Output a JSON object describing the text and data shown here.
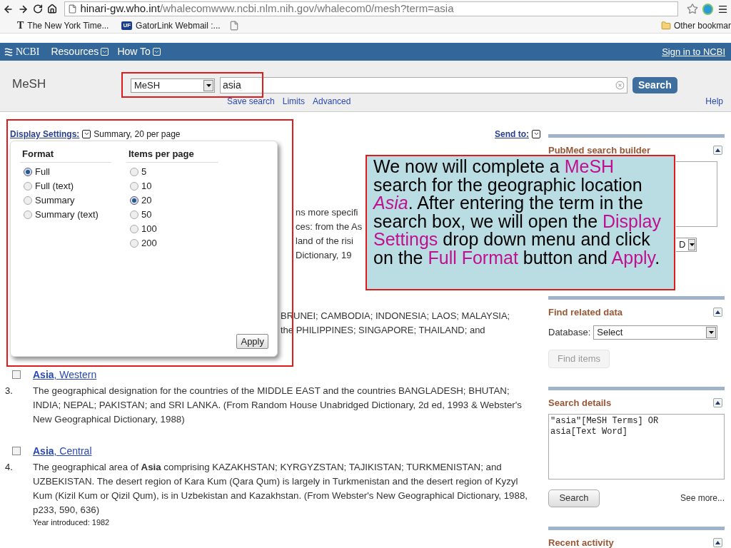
{
  "browser": {
    "url_host": "hinari-gw.who.int",
    "url_path": "/whalecomwww.ncbi.nlm.nih.gov/whalecom0/mesh?term=asia",
    "bookmarks": [
      {
        "kind": "nyt",
        "badge": "T",
        "label": "The New York Time..."
      },
      {
        "kind": "uf",
        "badge": "UF",
        "label": "GatorLink Webmail :..."
      },
      {
        "kind": "page"
      }
    ],
    "other_bookmarks": "Other bookmar"
  },
  "ncbi_bar": {
    "logo": "NCBI",
    "menus": [
      "Resources",
      "How To"
    ],
    "sign_in": "Sign in to NCBI"
  },
  "search": {
    "title": "MeSH",
    "database": "MeSH",
    "query": "asia",
    "button": "Search",
    "links": [
      "Save search",
      "Limits",
      "Advanced"
    ],
    "help": "Help"
  },
  "display": {
    "label": "Display Settings:",
    "summary": "Summary, 20 per page",
    "send_to": "Send to:"
  },
  "popup": {
    "format_heading": "Format",
    "formats": [
      {
        "label": "Full",
        "selected": true
      },
      {
        "label": "Full (text)",
        "selected": false
      },
      {
        "label": "Summary",
        "selected": false
      },
      {
        "label": "Summary (text)",
        "selected": false
      }
    ],
    "items_heading": "Items per page",
    "items": [
      {
        "label": "5",
        "selected": false
      },
      {
        "label": "10",
        "selected": false
      },
      {
        "label": "20",
        "selected": true
      },
      {
        "label": "50",
        "selected": false
      },
      {
        "label": "100",
        "selected": false
      },
      {
        "label": "200",
        "selected": false
      }
    ],
    "apply": "Apply"
  },
  "fragments": [
    "ns more specifi",
    "ces: from the As",
    "land of the risi",
    "Dictionary, 19"
  ],
  "fragments_2": [
    "BRUNEI; CAMBODIA; INDONESIA; LAOS; MALAYSIA;",
    "the PHILIPPINES; SINGAPORE; THAILAND; and"
  ],
  "results": [
    {
      "number": "3.",
      "title": "**Asia**, Western",
      "checked": false,
      "description": "The geographical designation for the countries of the MIDDLE EAST and the countries BANGLADESH; BHUTAN; INDIA; NEPAL; PAKISTAN; and SRI LANKA. (From Random House Unabridged Dictionary, 2d ed, 1993 & Webster's New Geographical Dictionary, 1988)"
    },
    {
      "number": "4.",
      "title": "**Asia**, Central",
      "checked": false,
      "description": "The geographical area of **Asia** comprising KAZAKHSTAN; KYRGYZSTAN; TAJIKISTAN; TURKMENISTAN; and UZBEKISTAN. The desert region of Kara Kum (Qara Qum) is largely in Turkmenistan and the desert region of Kyzyl Kum (Kizil Kum or Qizil Qum), is in Uzbekistan and Kazakhstan. (From Webster's New Geographical Dictionary, 1988, p233, 590, 636)",
      "year": "Year introduced: 1982"
    }
  ],
  "sidebar": [
    {
      "kind": "builder",
      "title": "PubMed search builder",
      "select_value": "D"
    },
    {
      "kind": "related",
      "title": "Find related data",
      "database_label": "Database:",
      "select_value": "Select",
      "button": "Find items",
      "disabled": true
    },
    {
      "kind": "details",
      "title": "Search details",
      "query": "\"asia\"[MeSH Terms] OR\nasia[Text Word]",
      "button": "Search",
      "see_more": "See more..."
    },
    {
      "kind": "recent",
      "title": "Recent activity"
    }
  ],
  "callout": [
    {
      "text": "We now will complete a ",
      "highlight": false
    },
    {
      "text": "MeSH",
      "highlight": true
    },
    {
      "text": " search for the geographic location ",
      "highlight": false
    },
    {
      "text": "*Asia*",
      "highlight": true
    },
    {
      "text": ".  After entering the term in the search box, we will open the ",
      "highlight": false
    },
    {
      "text": "Display Settings",
      "highlight": true
    },
    {
      "text": " drop down menu and click on the ",
      "highlight": false
    },
    {
      "text": "Full Format",
      "highlight": true
    },
    {
      "text": " button and ",
      "highlight": false
    },
    {
      "text": "Apply",
      "highlight": true
    },
    {
      "text": ".",
      "highlight": false
    }
  ]
}
